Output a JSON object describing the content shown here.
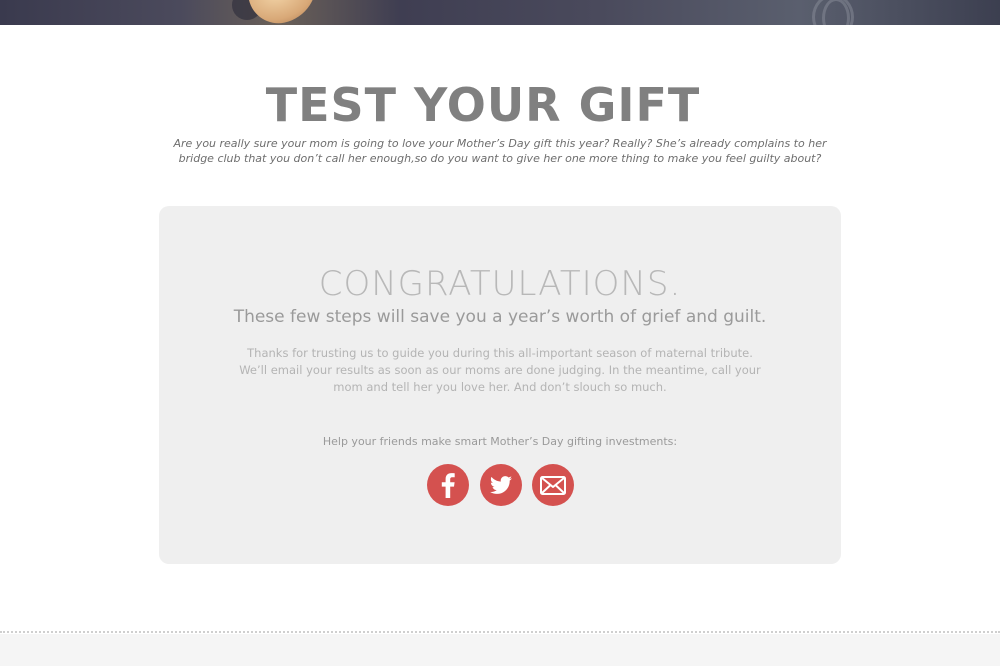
{
  "hero": {
    "image_description_icon": "hero-photo-strip"
  },
  "header": {
    "title": "TEST YOUR GIFT",
    "intro": "Are you really sure your mom is going to love your Mother’s Day gift this year? Really? She’s already complains to her bridge club that you don’t call her enough,so do you want to give her one more thing to make you feel guilty about?"
  },
  "result": {
    "heading": "CONGRATULATIONS.",
    "subheading": "These few steps will save you a year’s worth of grief and guilt.",
    "body": "Thanks for trusting us to guide you during this all-important season of maternal tribute. We’ll email your results as soon as our moms are done judging. In the meantime, call your mom and tell her you love her. And don’t slouch so much."
  },
  "share": {
    "label": "Help your friends make smart Mother’s Day gifting investments:",
    "buttons": [
      {
        "icon": "facebook-icon"
      },
      {
        "icon": "twitter-icon"
      },
      {
        "icon": "email-icon"
      }
    ]
  },
  "colors": {
    "accent": "#d4514f",
    "panel": "#efefef",
    "title": "#808080"
  }
}
